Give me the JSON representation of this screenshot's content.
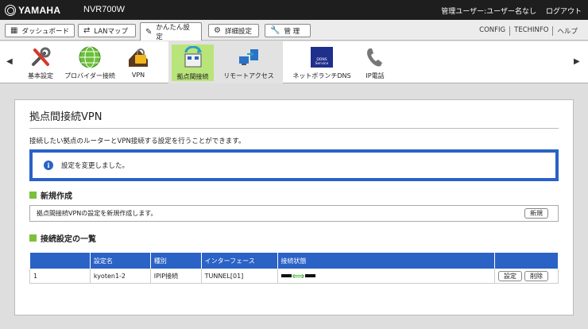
{
  "header": {
    "brand": "YAMAHA",
    "model": "NVR700W",
    "user_label": "管理ユーザー:ユーザー名なし",
    "logout": "ログアウト"
  },
  "tabs": [
    {
      "label": "ダッシュボード",
      "icon": "dashboard-icon"
    },
    {
      "label": "LANマップ",
      "icon": "lan-map-icon"
    },
    {
      "label": "かんたん設定",
      "icon": "wizard-icon",
      "active": true
    },
    {
      "label": "詳細設定",
      "icon": "gear-icon"
    },
    {
      "label": "管 理",
      "icon": "wrench-icon"
    }
  ],
  "top_links": [
    "CONFIG",
    "TECHINFO",
    "ヘルプ"
  ],
  "toolbar": {
    "items": [
      {
        "label": "基本設定",
        "icon": "tools-icon"
      },
      {
        "label": "プロバイダー接続",
        "icon": "globe-icon"
      },
      {
        "label": "VPN",
        "icon": "vpn-lock-icon"
      },
      {
        "label": "拠点間接続",
        "icon": "site-to-site-icon",
        "selected": true
      },
      {
        "label": "リモートアクセス",
        "icon": "remote-access-icon"
      },
      {
        "label": "ネットボランチDNS",
        "icon": "ddns-icon",
        "badge_text": "DDNS Service"
      },
      {
        "label": "IP電話",
        "icon": "phone-icon"
      }
    ]
  },
  "page": {
    "title": "拠点間接続VPN",
    "description": "接続したい拠点のルーターとVPN接続する設定を行うことができます。",
    "notice": "設定を変更しました。"
  },
  "create_section": {
    "heading": "新規作成",
    "text": "拠点間接続VPNの設定を新規作成します。",
    "button": "新規"
  },
  "list_section": {
    "heading": "接続設定の一覧",
    "columns": [
      "",
      "設定名",
      "種別",
      "インターフェース",
      "接続状態",
      ""
    ],
    "rows": [
      {
        "no": "1",
        "name": "kyoten1-2",
        "type": "IPIP接続",
        "interface": "TUNNEL[01]",
        "status": "connected",
        "edit": "設定",
        "delete": "削除"
      }
    ]
  },
  "colors": {
    "accent": "#2a62c6",
    "section_marker": "#7cc13b",
    "selected_tool": "#b9e47a",
    "status_arrow": "#4bb33a"
  }
}
